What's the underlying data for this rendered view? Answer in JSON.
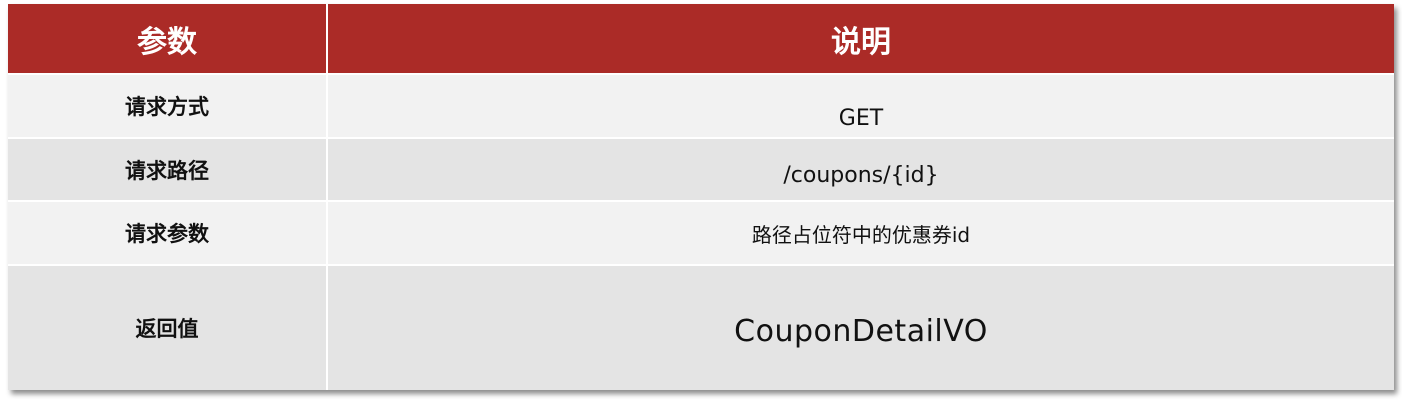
{
  "table": {
    "headers": {
      "param": "参数",
      "desc": "说明"
    },
    "rows": [
      {
        "label": "请求方式",
        "value": "GET"
      },
      {
        "label": "请求路径",
        "value": "/coupons/{id}"
      },
      {
        "label": "请求参数",
        "value": "路径占位符中的优惠券id"
      },
      {
        "label": "返回值",
        "value": "CouponDetailVO"
      }
    ]
  },
  "colors": {
    "header_bg": "#ab2b27",
    "header_text": "#ffffff",
    "row_light": "#f2f2f2",
    "row_dark": "#e4e4e4"
  }
}
